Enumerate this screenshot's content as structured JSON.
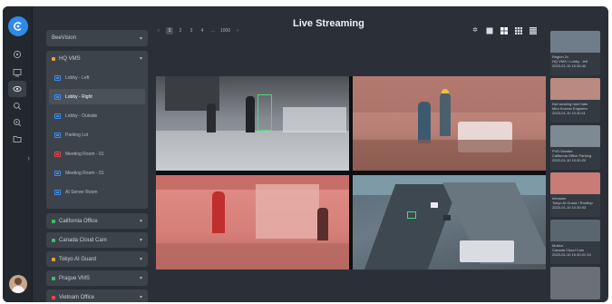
{
  "header": {
    "title": "Live Streaming"
  },
  "pagination": {
    "pages": [
      "1",
      "2",
      "3",
      "4",
      "...",
      "1000"
    ],
    "prev": "‹",
    "next": "›",
    "active_index": 0
  },
  "layout_buttons": [
    "settings",
    "single",
    "2x2",
    "3x3",
    "4x4"
  ],
  "tree": {
    "root": "BeeVision",
    "site": "HQ VMS",
    "cameras": [
      {
        "label": "Lobby - Left",
        "active": false,
        "alert": false
      },
      {
        "label": "Lobby - Right",
        "active": true,
        "alert": false
      },
      {
        "label": "Lobby - Outside",
        "active": false,
        "alert": false
      },
      {
        "label": "Parking Lot",
        "active": false,
        "alert": false
      },
      {
        "label": "Meeting Room - 01",
        "active": false,
        "alert": true
      },
      {
        "label": "Meeting Room - 01",
        "active": false,
        "alert": false
      },
      {
        "label": "AI Server Room",
        "active": false,
        "alert": false
      }
    ],
    "groups": [
      {
        "label": "California Office",
        "color": "#3fbf6a"
      },
      {
        "label": "Canada Cloud Cam",
        "color": "#3fbf6a"
      },
      {
        "label": "Tokyo AI Guard",
        "color": "#e6a23c"
      },
      {
        "label": "Prague VMS",
        "color": "#3fbf6a"
      },
      {
        "label": "Vietnam Office",
        "color": "#e14a4a"
      }
    ]
  },
  "events": [
    {
      "title": "Region 2x",
      "line2": "HQ VMS / Lobby - left",
      "line3": "2023-01-10 10:30:40",
      "color": "#6f7d8a"
    },
    {
      "title": "Not wearing hard hats",
      "line2": "Mira Korean Engineer",
      "line3": "2023-01-10 10:30:11",
      "color": "#b88a80"
    },
    {
      "title": "PVD Monitor",
      "line2": "California Office Parking",
      "line3": "2023-01-10 10:30:20",
      "color": "#7d8a93"
    },
    {
      "title": "Intrusion",
      "line2": "Tokyo AI Guard / Rooftop",
      "line3": "2023-01-10 10:30:03",
      "color": "#c97b76"
    },
    {
      "title": "Motion",
      "line2": "Canada Cloud Cam",
      "line3": "2023-01-10 10:30:21 04",
      "color": "#596670"
    },
    {
      "title": "",
      "line2": "",
      "line3": "",
      "color": "#6a7076"
    }
  ],
  "colors": {
    "accent": "#2f8ae6",
    "background": "#2b3038"
  }
}
